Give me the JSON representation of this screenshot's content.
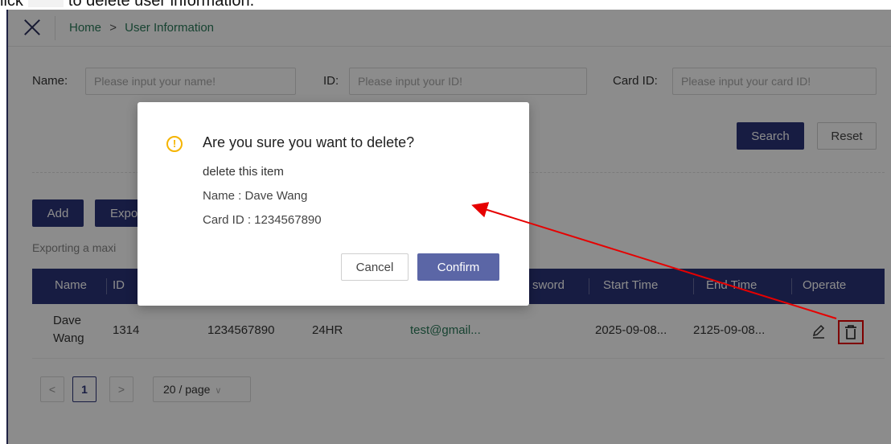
{
  "caption": {
    "text_before": "lick",
    "text_after": "to delete user information."
  },
  "topbar": {
    "breadcrumb_home": "Home",
    "breadcrumb_sep": ">",
    "breadcrumb_current": "User Information"
  },
  "filters": {
    "name_label": "Name:",
    "name_placeholder": "Please input your name!",
    "id_label": "ID:",
    "id_placeholder": "Please input your ID!",
    "card_label": "Card ID:",
    "card_placeholder": "Please input your card ID!",
    "search_label": "Search",
    "reset_label": "Reset"
  },
  "actions": {
    "add_label": "Add",
    "export_label": "Expo"
  },
  "hint": "Exporting a maxi",
  "table": {
    "headers": [
      "Name",
      "ID",
      "sword",
      "Start Time",
      "End Time",
      "Operate"
    ],
    "row": {
      "name": "Dave Wang",
      "name_line1": "Dave",
      "name_line2": "Wang",
      "id": "1314",
      "card_id": "1234567890",
      "hours": "24HR",
      "email": "test@gmail...",
      "start_time": "2025-09-08...",
      "end_time": "2125-09-08..."
    }
  },
  "pagination": {
    "prev": "<",
    "current": "1",
    "next": ">",
    "page_size": "20 / page"
  },
  "modal": {
    "title": "Are you sure you want to delete?",
    "subtitle": "delete this item",
    "name_line": "Name : Dave Wang",
    "card_line": "Card ID : 1234567890",
    "cancel_label": "Cancel",
    "confirm_label": "Confirm"
  },
  "colors": {
    "primary": "#2b3378",
    "confirm": "#5b66a6",
    "warning": "#f5b400",
    "annotation": "#e60000",
    "link": "#2a7a5a"
  }
}
